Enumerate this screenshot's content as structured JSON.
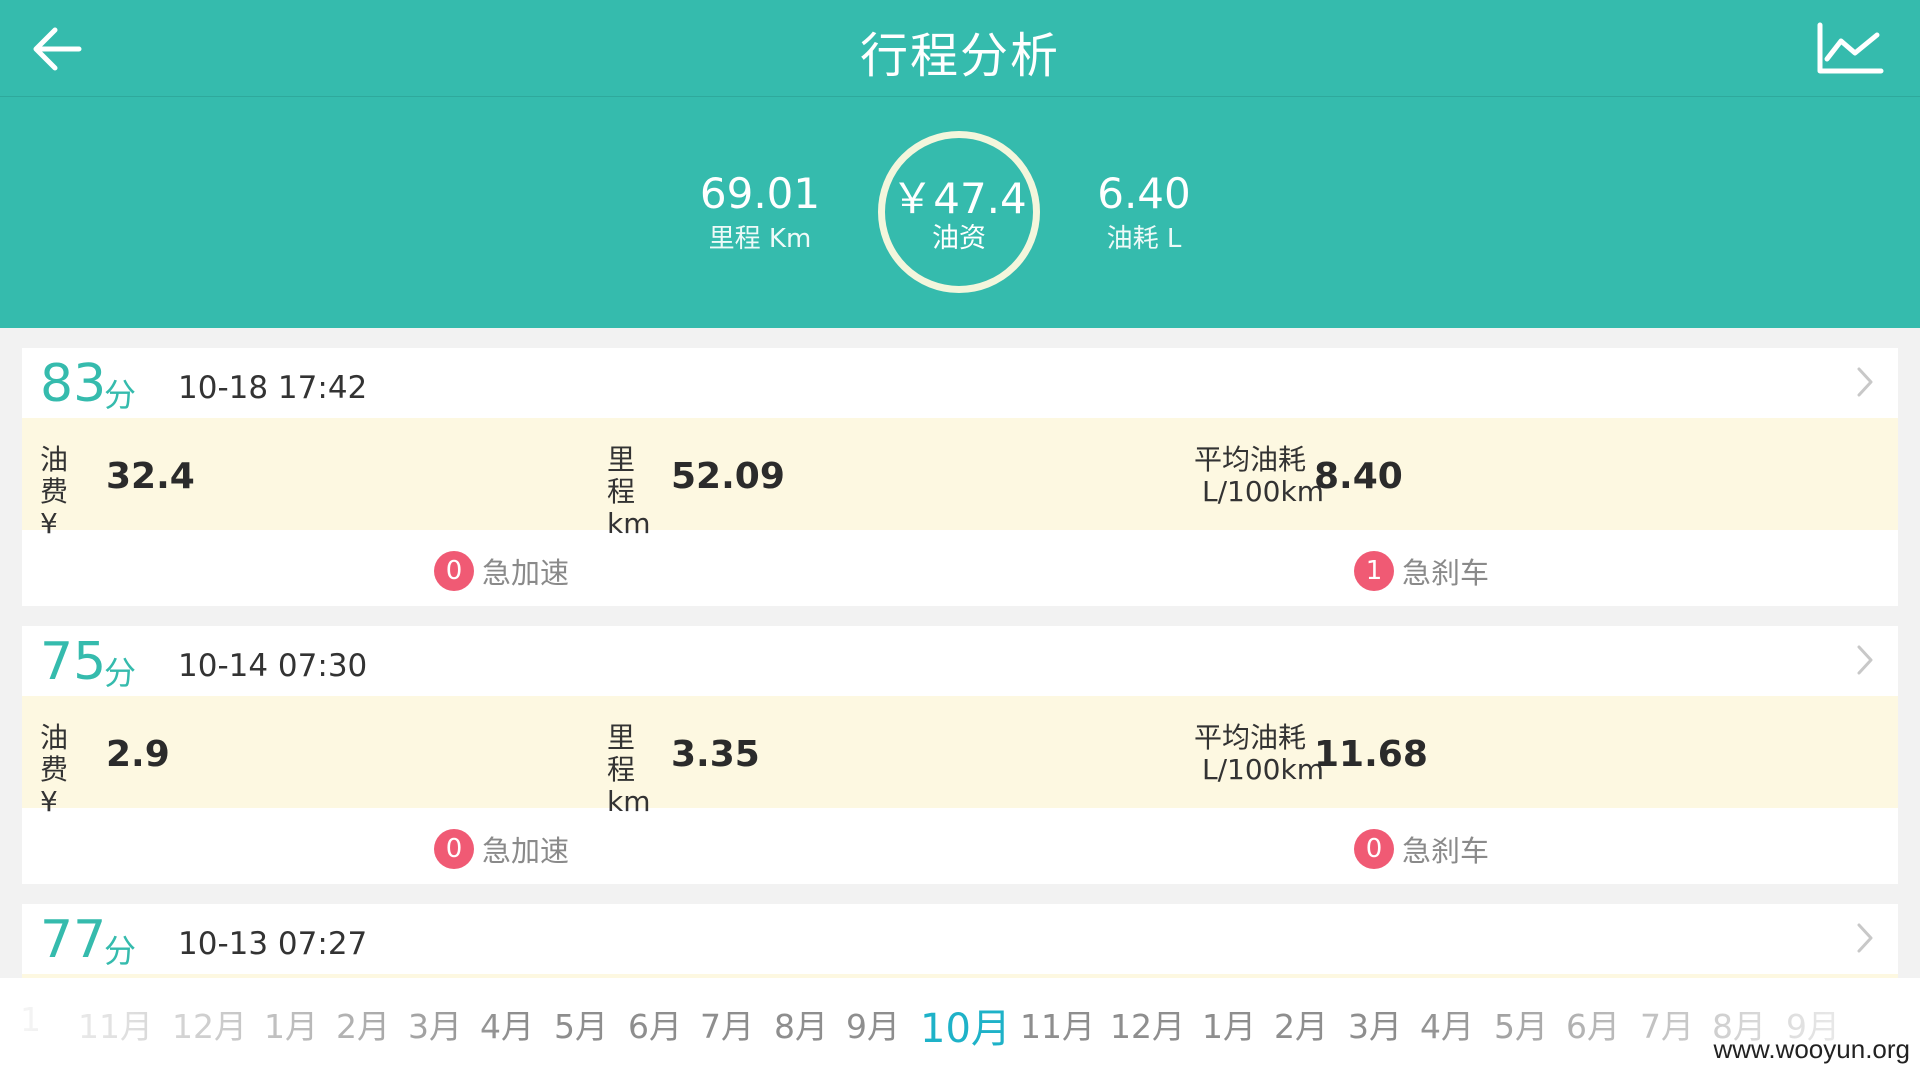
{
  "header": {
    "title": "行程分析",
    "back_icon": "arrow-left-icon",
    "chart_icon": "line-chart-icon"
  },
  "summary": {
    "mileage": {
      "value": "69.01",
      "label": "里程 Km"
    },
    "cost": {
      "value": "￥47.4",
      "label": "油资"
    },
    "fuel": {
      "value": "6.40",
      "label": "油耗 L"
    }
  },
  "trips": [
    {
      "score": "83",
      "score_unit": "分",
      "time": "10-18 17:42",
      "fuel_cost": {
        "label1": "油费",
        "label2": "¥",
        "value": "32.4"
      },
      "mileage": {
        "label1": "里程",
        "label2": "km",
        "value": "52.09"
      },
      "avg_fuel": {
        "label1": "平均油耗",
        "label2": "L/100km",
        "value": "8.40"
      },
      "accel": {
        "count": "0",
        "label": "急加速"
      },
      "brake": {
        "count": "1",
        "label": "急刹车"
      }
    },
    {
      "score": "75",
      "score_unit": "分",
      "time": "10-14 07:30",
      "fuel_cost": {
        "label1": "油费",
        "label2": "¥",
        "value": "2.9"
      },
      "mileage": {
        "label1": "里程",
        "label2": "km",
        "value": "3.35"
      },
      "avg_fuel": {
        "label1": "平均油耗",
        "label2": "L/100km",
        "value": "11.68"
      },
      "accel": {
        "count": "0",
        "label": "急加速"
      },
      "brake": {
        "count": "0",
        "label": "急刹车"
      }
    },
    {
      "score": "77",
      "score_unit": "分",
      "time": "10-13 07:27"
    }
  ],
  "months": {
    "items": [
      "1",
      "11月",
      "12月",
      "1月",
      "2月",
      "3月",
      "4月",
      "5月",
      "6月",
      "7月",
      "8月",
      "9月",
      "10月",
      "11月",
      "12月",
      "1月",
      "2月",
      "3月",
      "4月",
      "5月",
      "6月",
      "7月",
      "8月",
      "9月"
    ],
    "active_index": 12
  },
  "watermark": "www.wooyun.org",
  "colors": {
    "header_bg": "#35bbad",
    "accent": "#35bbad",
    "active_month": "#1eb2c8",
    "badge": "#f05a74",
    "metrics_bg": "#fdf8e1"
  }
}
